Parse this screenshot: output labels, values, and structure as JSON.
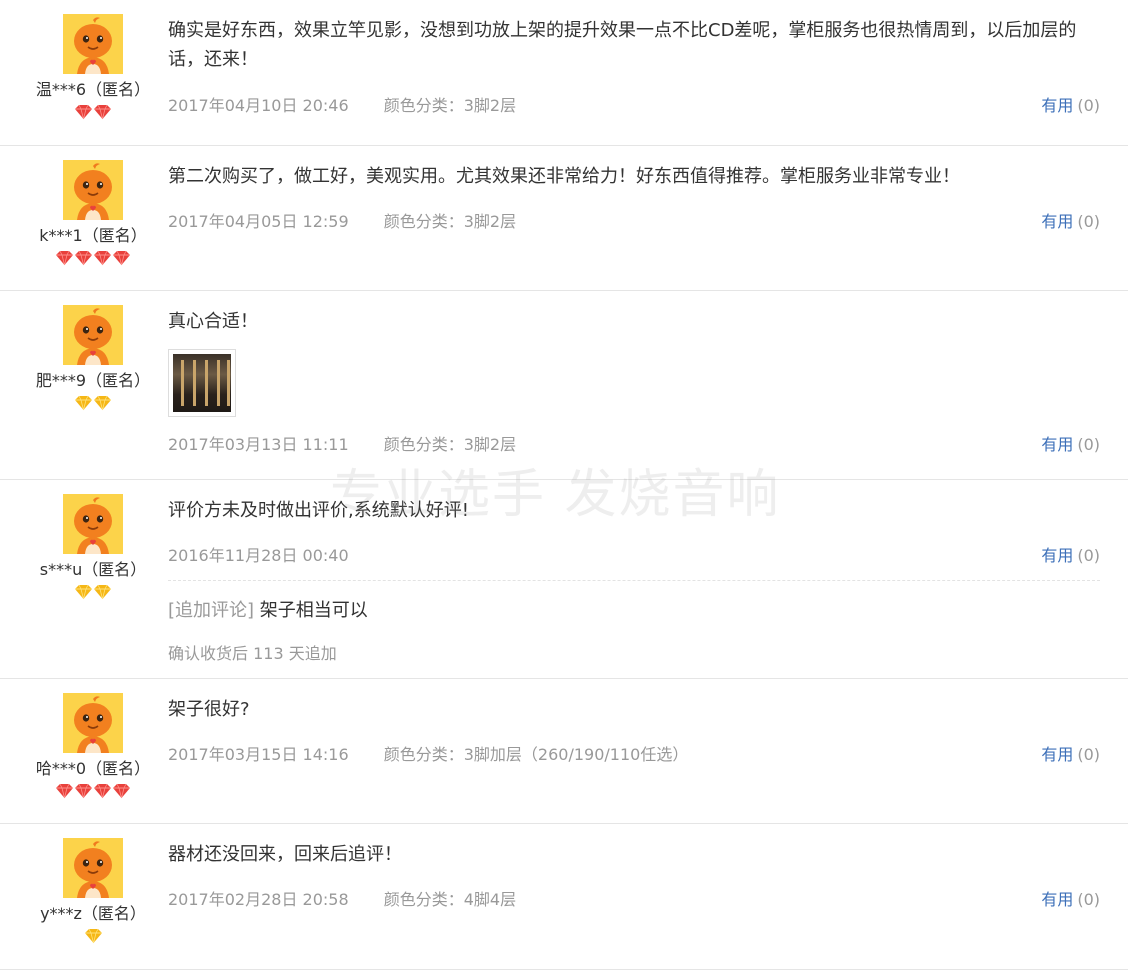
{
  "useful_label": "有用",
  "watermark": "专业选手 发烧音响",
  "reviews": [
    {
      "user": "温***6（匿名）",
      "gems": [
        "red",
        "red"
      ],
      "text": "确实是好东西，效果立竿见影，没想到功放上架的提升效果一点不比CD差呢，掌柜服务也很热情周到，以后加层的话，还来！",
      "date": "2017年04月10日 20:46",
      "sku": "颜色分类：3脚2层",
      "useful_count": "(0)"
    },
    {
      "user": "k***1（匿名）",
      "gems": [
        "red",
        "red",
        "red",
        "red"
      ],
      "text": "第二次购买了，做工好，美观实用。尤其效果还非常给力！好东西值得推荐。掌柜服务业非常专业！",
      "date": "2017年04月05日 12:59",
      "sku": "颜色分类：3脚2层",
      "useful_count": "(0)"
    },
    {
      "user": "肥***9（匿名）",
      "gems": [
        "yellow",
        "yellow"
      ],
      "text": "真心合适！",
      "has_photo": true,
      "date": "2017年03月13日 11:11",
      "sku": "颜色分类：3脚2层",
      "useful_count": "(0)"
    },
    {
      "user": "s***u（匿名）",
      "gems": [
        "yellow",
        "yellow"
      ],
      "text": "评价方未及时做出评价,系统默认好评!",
      "date": "2016年11月28日 00:40",
      "sku": "",
      "useful_count": "(0)",
      "append_tag": "[追加评论]",
      "append_text": "架子相当可以",
      "append_time": "确认收货后 113 天追加"
    },
    {
      "user": "哈***0（匿名）",
      "gems": [
        "red",
        "red",
        "red",
        "red"
      ],
      "text": "架子很好?",
      "date": "2017年03月15日 14:16",
      "sku": "颜色分类：3脚加层（260/190/110任选）",
      "useful_count": "(0)"
    },
    {
      "user": "y***z（匿名）",
      "gems": [
        "yellow"
      ],
      "text": "器材还没回来，回来后追评！",
      "date": "2017年02月28日 20:58",
      "sku": "颜色分类：4脚4层",
      "useful_count": "(0)"
    }
  ],
  "colors": {
    "gem_red": "#e8413c",
    "gem_yellow": "#f5b716",
    "link_blue": "#3c6fb8",
    "meta_gray": "#999999"
  }
}
